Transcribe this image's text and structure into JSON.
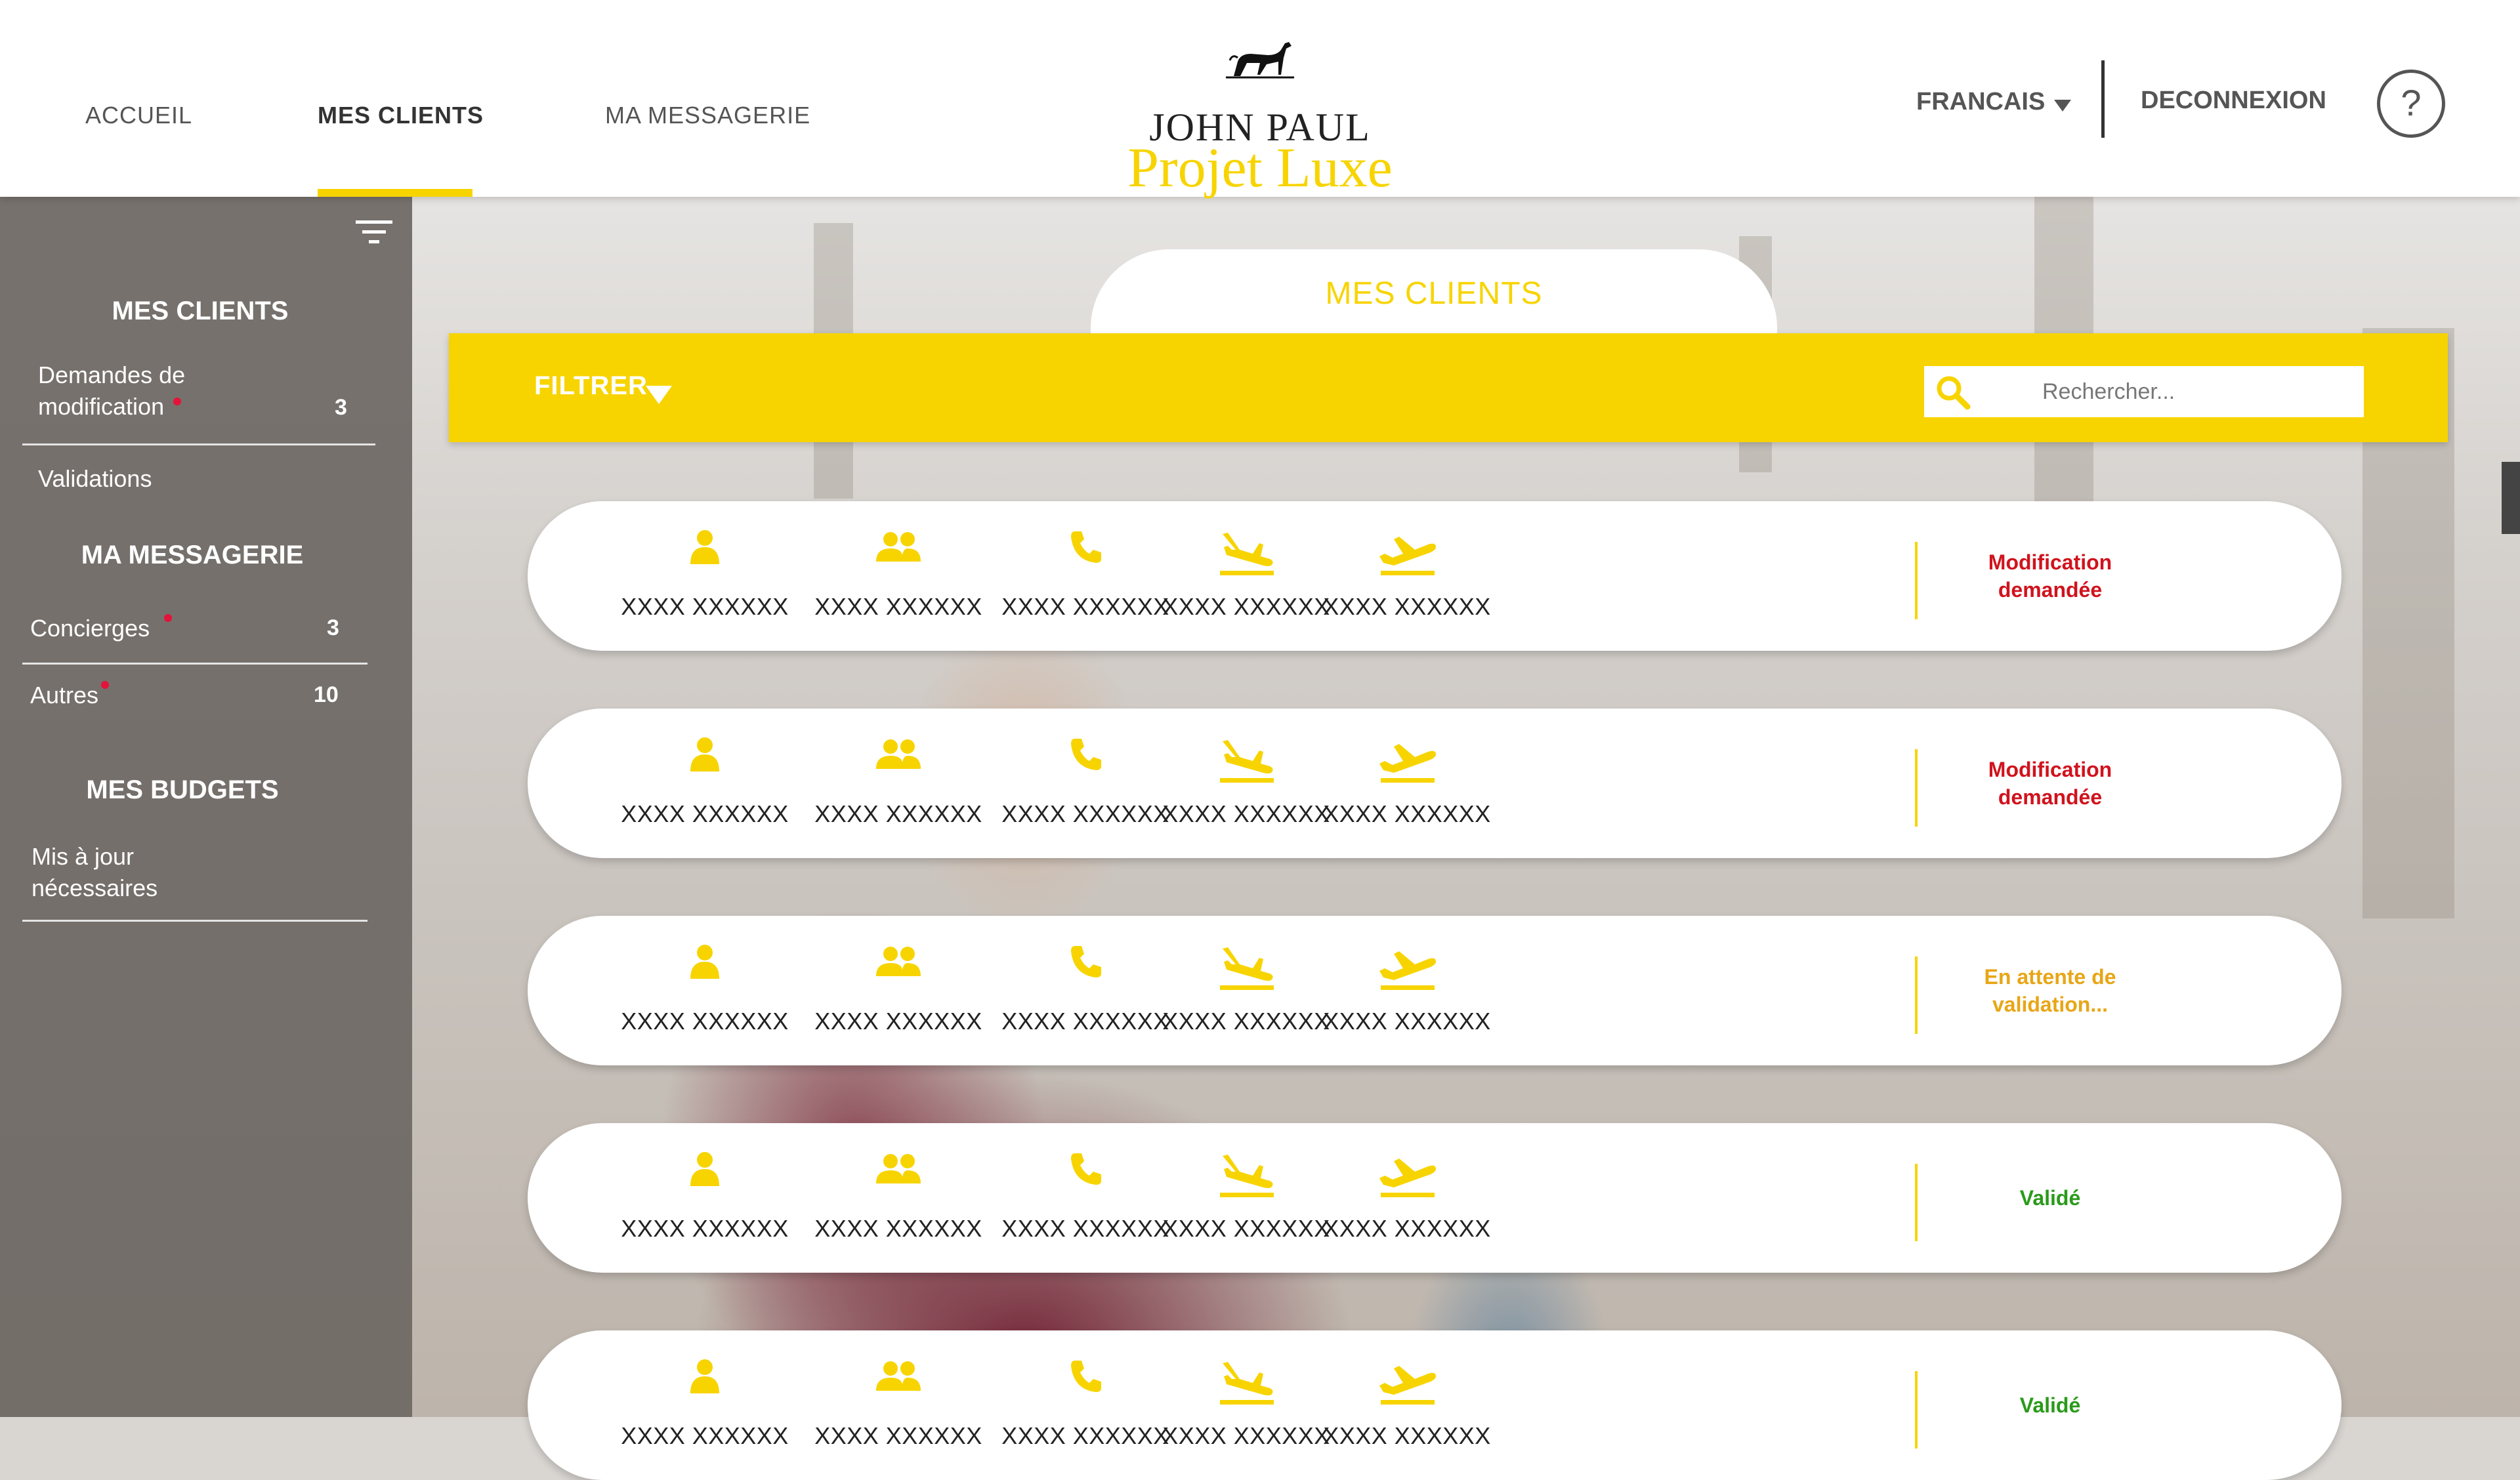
{
  "header": {
    "nav": [
      {
        "label": "ACCUEIL",
        "active": false
      },
      {
        "label": "MES CLIENTS",
        "active": true
      },
      {
        "label": "MA MESSAGERIE",
        "active": false
      }
    ],
    "logo": {
      "line1": "JOHN PAUL",
      "line2": "Projet Luxe"
    },
    "language": "FRANCAIS",
    "logout": "DECONNEXION",
    "help": "?"
  },
  "sidebar": {
    "clients_title": "MES CLIENTS",
    "demandes": {
      "label_line1": "Demandes de",
      "label_line2": "modification",
      "count": "3"
    },
    "validations": "Validations",
    "messagerie_title": "MA MESSAGERIE",
    "concierges": {
      "label": "Concierges",
      "count": "3"
    },
    "autres": {
      "label": "Autres",
      "count": "10"
    },
    "budgets_title": "MES BUDGETS",
    "mise_a_jour": {
      "label_line1": "Mis à jour",
      "label_line2": "nécessaires"
    }
  },
  "main": {
    "title": "MES CLIENTS",
    "filter_label": "FILTRER",
    "search_placeholder": "Rechercher...",
    "rows": [
      {
        "values": [
          "XXXX XXXXXX",
          "XXXX XXXXXX",
          "XXXX XXXXXX",
          "XXXX XXXXXX",
          "XXXX XXXXXX"
        ],
        "status_line1": "Modification",
        "status_line2": "demandée",
        "status_color": "#d0131d"
      },
      {
        "values": [
          "XXXX XXXXXX",
          "XXXX XXXXXX",
          "XXXX XXXXXX",
          "XXXX XXXXXX",
          "XXXX XXXXXX"
        ],
        "status_line1": "Modification",
        "status_line2": "demandée",
        "status_color": "#d0131d"
      },
      {
        "values": [
          "XXXX XXXXXX",
          "XXXX XXXXXX",
          "XXXX XXXXXX",
          "XXXX XXXXXX",
          "XXXX XXXXXX"
        ],
        "status_line1": "En attente de",
        "status_line2": "validation...",
        "status_color": "#e8a617"
      },
      {
        "values": [
          "XXXX XXXXXX",
          "XXXX XXXXXX",
          "XXXX XXXXXX",
          "XXXX XXXXXX",
          "XXXX XXXXXX"
        ],
        "status_line1": "Validé",
        "status_line2": "",
        "status_color": "#2a9a1a"
      },
      {
        "values": [
          "XXXX XXXXXX",
          "XXXX XXXXXX",
          "XXXX XXXXXX",
          "XXXX XXXXXX",
          "XXXX XXXXXX"
        ],
        "status_line1": "Validé",
        "status_line2": "",
        "status_color": "#2a9a1a"
      }
    ],
    "column_icons": [
      "person-icon",
      "group-icon",
      "phone-icon",
      "plane-landing-icon",
      "plane-takeoff-icon"
    ]
  },
  "colors": {
    "accent": "#f7d400",
    "sidebar": "#6e6864",
    "status_red": "#d0131d",
    "status_orange": "#e8a617",
    "status_green": "#2a9a1a"
  }
}
